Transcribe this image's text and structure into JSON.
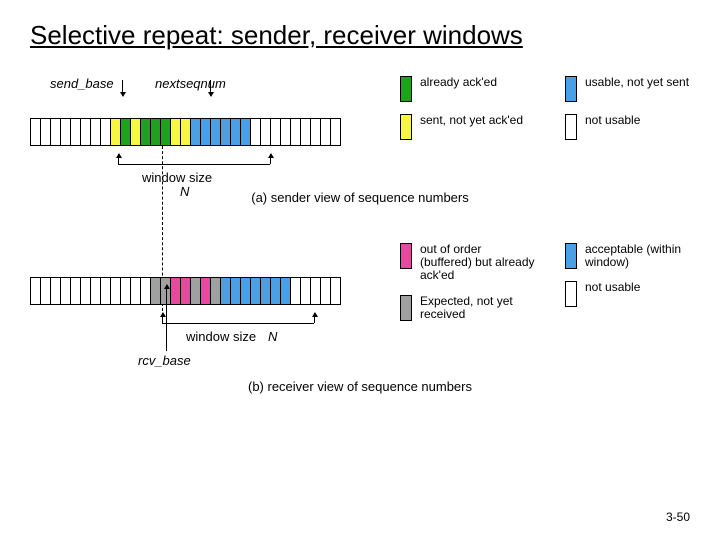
{
  "title": "Selective repeat: sender, receiver windows",
  "page_number": "3-50",
  "colors": {
    "yellow": "#f7f740",
    "green": "#1fa01f",
    "blue": "#4aa0e6",
    "pink": "#e64aa0",
    "gray": "#a0a0a0",
    "white": "#ffffff"
  },
  "sender": {
    "label_send_base": "send_base",
    "label_nextseqnum": "nextseqnum",
    "window_label": "window size",
    "window_size_symbol": "N",
    "caption": "(a) sender view of sequence numbers",
    "slots": [
      "white",
      "white",
      "white",
      "white",
      "white",
      "white",
      "white",
      "white",
      "yellow",
      "green",
      "yellow",
      "green",
      "green",
      "green",
      "yellow",
      "yellow",
      "blue",
      "blue",
      "blue",
      "blue",
      "blue",
      "blue",
      "white",
      "white",
      "white",
      "white",
      "white",
      "white",
      "white",
      "white",
      "white"
    ],
    "window_start_index": 8,
    "window_end_index": 21,
    "legend": [
      {
        "color": "green",
        "text": "already ack'ed"
      },
      {
        "color": "yellow",
        "text": "sent, not yet ack'ed"
      },
      {
        "color": "blue",
        "text": "usable, not yet sent"
      },
      {
        "color": "white",
        "text": "not usable"
      }
    ]
  },
  "receiver": {
    "label_rcv_base": "rcv_base",
    "window_label": "window size",
    "window_size_symbol": "N",
    "caption": "(b) receiver view of sequence numbers",
    "slots": [
      "white",
      "white",
      "white",
      "white",
      "white",
      "white",
      "white",
      "white",
      "white",
      "white",
      "white",
      "white",
      "gray",
      "gray",
      "pink",
      "pink",
      "gray",
      "pink",
      "gray",
      "blue",
      "blue",
      "blue",
      "blue",
      "blue",
      "blue",
      "blue",
      "white",
      "white",
      "white",
      "white",
      "white"
    ],
    "window_start_index": 12,
    "window_end_index": 25,
    "legend": [
      {
        "color": "pink",
        "text": "out of order (buffered) but already ack'ed"
      },
      {
        "color": "gray",
        "text": "Expected, not yet received"
      },
      {
        "color": "blue",
        "text": "acceptable (within window)"
      },
      {
        "color": "white",
        "text": "not usable"
      }
    ]
  }
}
